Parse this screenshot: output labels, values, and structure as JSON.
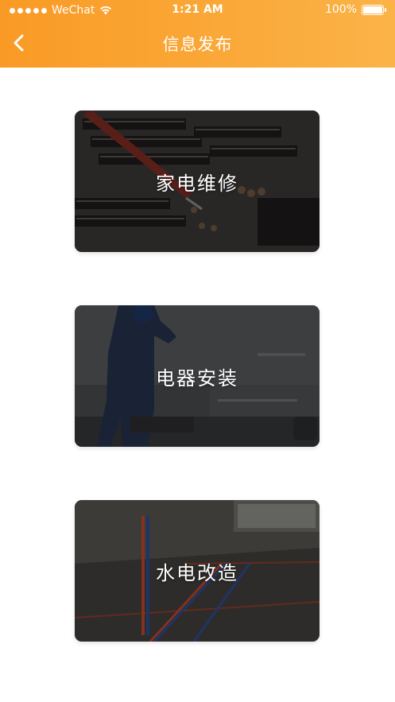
{
  "status_bar": {
    "carrier": "WeChat",
    "time": "1:21 AM",
    "battery": "100%"
  },
  "nav": {
    "title": "信息发布",
    "back_icon": "chevron-left-icon"
  },
  "cards": [
    {
      "label": "家电维修",
      "image": "circuit-board-photo"
    },
    {
      "label": "电器安装",
      "image": "technician-installing-photo"
    },
    {
      "label": "水电改造",
      "image": "floor-wiring-photo"
    }
  ],
  "colors": {
    "header_start": "#f99a25",
    "header_end": "#fbb347"
  }
}
